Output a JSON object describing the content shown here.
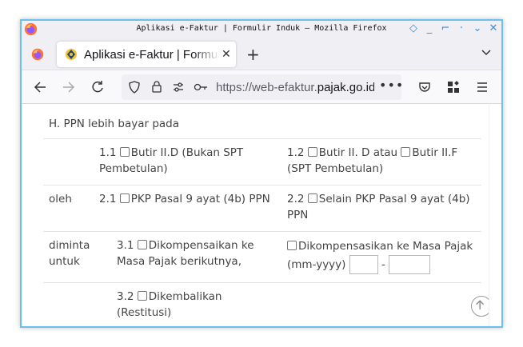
{
  "window": {
    "title": "Aplikasi e-Faktur | Formulir Induk — Mozilla Firefox"
  },
  "tabs": [
    {
      "label": "Aplikasi e-Faktur | Formulir Induk"
    }
  ],
  "navbar": {
    "url_prefix": "https://web-efaktur.",
    "url_domain": "pajak.go.id"
  },
  "form": {
    "section_h": "H. PPN lebih bayar pada",
    "row1": {
      "item_1_1_num": "1.1",
      "item_1_1_text": "Butir II.D (Bukan SPT Pembetulan)",
      "item_1_2_num": "1.2",
      "item_1_2_text_a": "Butir II. D atau",
      "item_1_2_text_b": "Butir II.F (SPT Pembetulan)"
    },
    "row2": {
      "label": "oleh",
      "item_2_1_num": "2.1",
      "item_2_1_text": "PKP Pasal 9 ayat (4b) PPN",
      "item_2_2_num": "2.2",
      "item_2_2_text": "Selain PKP Pasal 9 ayat (4b) PPN"
    },
    "row3": {
      "label": "diminta untuk",
      "item_3_1_num": "3.1",
      "item_3_1_text": "Dikompensaikan ke Masa Pajak berikutnya,",
      "kompensasi_text": "Dikompensasikan ke Masa Pajak (mm-yyyy)",
      "range_separator": "-",
      "item_3_2_num": "3.2",
      "item_3_2_text": "Dikembalikan (Restitusi)"
    }
  },
  "colors": {
    "window_border": "#6cc0f0",
    "text": "#444444",
    "chrome_bg": "#f0f0f4"
  }
}
